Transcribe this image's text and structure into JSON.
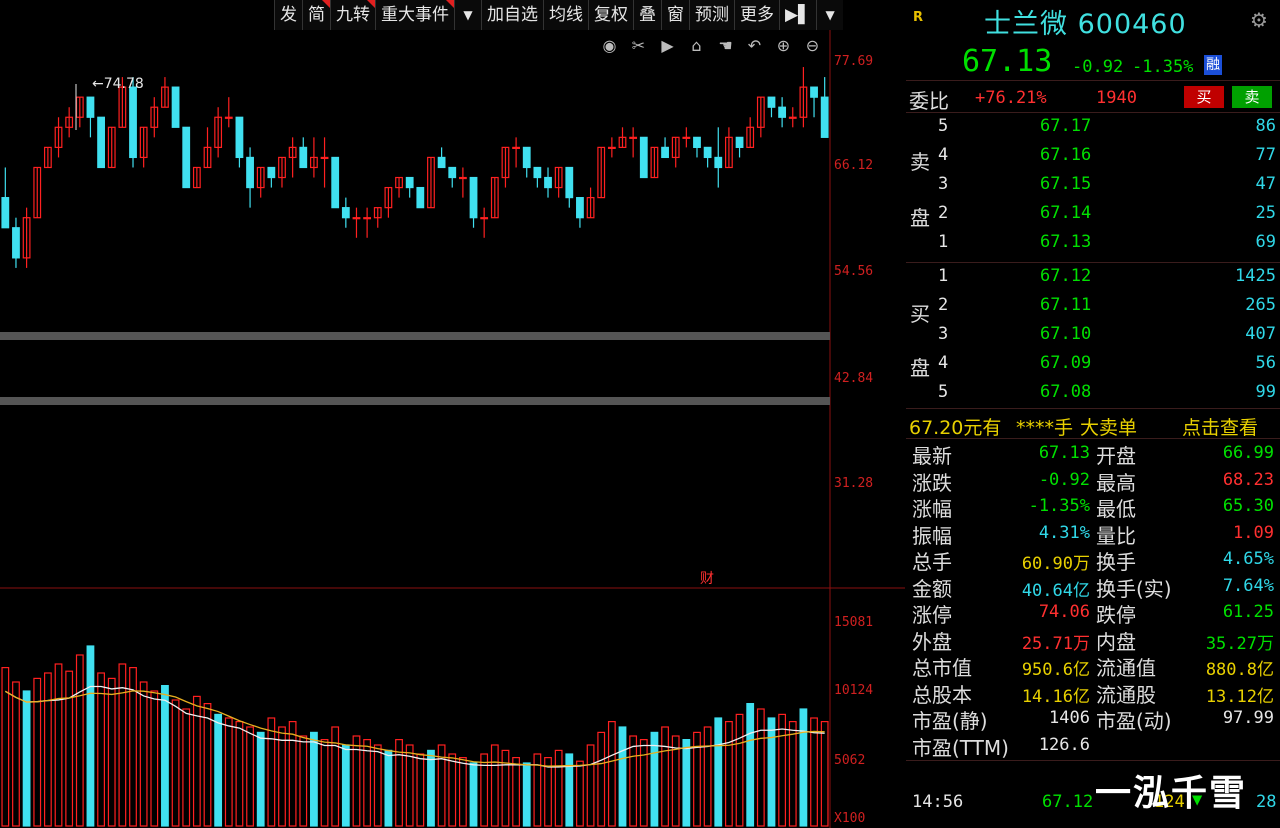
{
  "toolbar": [
    {
      "label": "发",
      "flag": false
    },
    {
      "label": "简",
      "flag": true
    },
    {
      "label": "九转",
      "flag": true
    },
    {
      "label": "重大事件",
      "flag": true
    },
    {
      "label": "▼",
      "flag": false
    },
    {
      "label": "加自选",
      "flag": false
    },
    {
      "label": "均线",
      "flag": false
    },
    {
      "label": "复权",
      "flag": false
    },
    {
      "label": "叠",
      "flag": false
    },
    {
      "label": "窗",
      "flag": false
    },
    {
      "label": "预测",
      "flag": false
    },
    {
      "label": "更多",
      "flag": false
    },
    {
      "label": "▶▌",
      "flag": false
    },
    {
      "label": "▼",
      "flag": false
    }
  ],
  "chart_tools": [
    "eye-icon",
    "scissors-icon",
    "play-icon",
    "lock-icon",
    "hand-icon",
    "undo-icon",
    "zoom-in-icon",
    "zoom-out-icon"
  ],
  "price_axis": [
    "77.69",
    "66.12",
    "54.56",
    "42.84",
    "31.28"
  ],
  "volume_axis": [
    "15081",
    "10124",
    "5062",
    "X100"
  ],
  "high_marker": "74.78",
  "cai_marker": "财",
  "chart_data": {
    "type": "candlestick",
    "series_colors": {
      "up": "#ff2020",
      "down": "#40e0f0",
      "ma_short": "#f0f0f0",
      "ma_long": "#e8b020"
    },
    "ohlc": [
      [
        63,
        66,
        60,
        60
      ],
      [
        60,
        61,
        57,
        56
      ],
      [
        57,
        62,
        61,
        56
      ],
      [
        61,
        66,
        66,
        61
      ],
      [
        66,
        68,
        68,
        66
      ],
      [
        68,
        71,
        70,
        67
      ],
      [
        70,
        72,
        71,
        69
      ],
      [
        71,
        73,
        73,
        70
      ],
      [
        73,
        73,
        71,
        69
      ],
      [
        71,
        71,
        66,
        66
      ],
      [
        66,
        70,
        70,
        66
      ],
      [
        70,
        75,
        74,
        70
      ],
      [
        74,
        75,
        67,
        66
      ],
      [
        67,
        70,
        70,
        66
      ],
      [
        70,
        73,
        72,
        69
      ],
      [
        72,
        75,
        74,
        72
      ],
      [
        74,
        74,
        70,
        70
      ],
      [
        70,
        70,
        64,
        64
      ],
      [
        64,
        66,
        66,
        64
      ],
      [
        66,
        70,
        68,
        66
      ],
      [
        68,
        72,
        71,
        67
      ],
      [
        71,
        73,
        71,
        70
      ],
      [
        71,
        71,
        67,
        66
      ],
      [
        67,
        68,
        64,
        62
      ],
      [
        64,
        66,
        66,
        63
      ],
      [
        66,
        66,
        65,
        64
      ],
      [
        65,
        67,
        67,
        64
      ],
      [
        67,
        69,
        68,
        65
      ],
      [
        68,
        69,
        66,
        66
      ],
      [
        66,
        69,
        67,
        65
      ],
      [
        67,
        69,
        67,
        64
      ],
      [
        67,
        67,
        62,
        62
      ],
      [
        62,
        63,
        61,
        60
      ],
      [
        61,
        62,
        61,
        59
      ],
      [
        61,
        62,
        61,
        59
      ],
      [
        61,
        62,
        62,
        60
      ],
      [
        62,
        64,
        64,
        61
      ],
      [
        64,
        65,
        65,
        63
      ],
      [
        65,
        65,
        64,
        63
      ],
      [
        64,
        64,
        62,
        62
      ],
      [
        62,
        67,
        67,
        62
      ],
      [
        67,
        68,
        66,
        66
      ],
      [
        66,
        66,
        65,
        64
      ],
      [
        65,
        66,
        65,
        63
      ],
      [
        65,
        65,
        61,
        60
      ],
      [
        61,
        62,
        61,
        59
      ],
      [
        61,
        65,
        65,
        61
      ],
      [
        65,
        68,
        68,
        64
      ],
      [
        68,
        69,
        68,
        66
      ],
      [
        68,
        68,
        66,
        65
      ],
      [
        66,
        66,
        65,
        64
      ],
      [
        65,
        66,
        64,
        63
      ],
      [
        64,
        66,
        66,
        63
      ],
      [
        66,
        66,
        63,
        62
      ],
      [
        63,
        63,
        61,
        60
      ],
      [
        61,
        64,
        63,
        61
      ],
      [
        63,
        68,
        68,
        63
      ],
      [
        68,
        69,
        68,
        67
      ],
      [
        68,
        70,
        69,
        68
      ],
      [
        69,
        70,
        69,
        67
      ],
      [
        69,
        69,
        65,
        65
      ],
      [
        65,
        68,
        68,
        65
      ],
      [
        68,
        69,
        67,
        67
      ],
      [
        67,
        69,
        69,
        66
      ],
      [
        69,
        70,
        69,
        68
      ],
      [
        69,
        69,
        68,
        67
      ],
      [
        68,
        68,
        67,
        66
      ],
      [
        67,
        70,
        66,
        64
      ],
      [
        66,
        70,
        69,
        66
      ],
      [
        69,
        69,
        68,
        67
      ],
      [
        68,
        71,
        70,
        68
      ],
      [
        70,
        73,
        73,
        69
      ],
      [
        73,
        73,
        72,
        71
      ],
      [
        72,
        73,
        71,
        70
      ],
      [
        71,
        72,
        71,
        70
      ],
      [
        71,
        76,
        74,
        70
      ],
      [
        74,
        74,
        73,
        71
      ],
      [
        73,
        75,
        69,
        69
      ]
    ],
    "volume": [
      [
        88,
        0
      ],
      [
        80,
        0
      ],
      [
        75,
        1
      ],
      [
        82,
        0
      ],
      [
        85,
        0
      ],
      [
        90,
        0
      ],
      [
        86,
        0
      ],
      [
        95,
        0
      ],
      [
        100,
        1
      ],
      [
        85,
        0
      ],
      [
        82,
        0
      ],
      [
        90,
        0
      ],
      [
        88,
        0
      ],
      [
        80,
        0
      ],
      [
        75,
        0
      ],
      [
        78,
        1
      ],
      [
        70,
        0
      ],
      [
        65,
        0
      ],
      [
        72,
        0
      ],
      [
        68,
        0
      ],
      [
        62,
        1
      ],
      [
        60,
        0
      ],
      [
        58,
        0
      ],
      [
        55,
        0
      ],
      [
        52,
        1
      ],
      [
        60,
        0
      ],
      [
        55,
        0
      ],
      [
        58,
        0
      ],
      [
        50,
        0
      ],
      [
        52,
        1
      ],
      [
        48,
        0
      ],
      [
        55,
        0
      ],
      [
        45,
        1
      ],
      [
        50,
        0
      ],
      [
        48,
        0
      ],
      [
        45,
        0
      ],
      [
        42,
        1
      ],
      [
        48,
        0
      ],
      [
        45,
        0
      ],
      [
        40,
        0
      ],
      [
        42,
        1
      ],
      [
        45,
        0
      ],
      [
        40,
        0
      ],
      [
        38,
        0
      ],
      [
        35,
        1
      ],
      [
        40,
        0
      ],
      [
        45,
        0
      ],
      [
        42,
        0
      ],
      [
        38,
        0
      ],
      [
        35,
        1
      ],
      [
        40,
        0
      ],
      [
        38,
        0
      ],
      [
        42,
        0
      ],
      [
        40,
        1
      ],
      [
        36,
        0
      ],
      [
        45,
        0
      ],
      [
        52,
        0
      ],
      [
        58,
        0
      ],
      [
        55,
        1
      ],
      [
        50,
        0
      ],
      [
        48,
        0
      ],
      [
        52,
        1
      ],
      [
        55,
        0
      ],
      [
        50,
        0
      ],
      [
        48,
        1
      ],
      [
        52,
        0
      ],
      [
        55,
        0
      ],
      [
        60,
        1
      ],
      [
        58,
        0
      ],
      [
        62,
        0
      ],
      [
        68,
        1
      ],
      [
        65,
        0
      ],
      [
        60,
        1
      ],
      [
        62,
        0
      ],
      [
        58,
        0
      ],
      [
        65,
        1
      ],
      [
        60,
        0
      ],
      [
        58,
        0
      ]
    ]
  },
  "stock": {
    "badge": "R",
    "name": "士兰微",
    "code": "600460",
    "price": "67.13",
    "change": "-0.92",
    "change_pct": "-1.35%",
    "rong": "融"
  },
  "weibi": {
    "label": "委比",
    "pct": "+76.21%",
    "diff": "1940",
    "buy": "买",
    "sell": "卖"
  },
  "sell_side": {
    "label_chars": [
      "卖",
      "盘"
    ],
    "rows": [
      {
        "lvl": "5",
        "price": "67.17",
        "vol": "86"
      },
      {
        "lvl": "4",
        "price": "67.16",
        "vol": "77"
      },
      {
        "lvl": "3",
        "price": "67.15",
        "vol": "47"
      },
      {
        "lvl": "2",
        "price": "67.14",
        "vol": "25"
      },
      {
        "lvl": "1",
        "price": "67.13",
        "vol": "69"
      }
    ]
  },
  "buy_side": {
    "label_chars": [
      "买",
      "盘"
    ],
    "rows": [
      {
        "lvl": "1",
        "price": "67.12",
        "vol": "1425"
      },
      {
        "lvl": "2",
        "price": "67.11",
        "vol": "265"
      },
      {
        "lvl": "3",
        "price": "67.10",
        "vol": "407"
      },
      {
        "lvl": "4",
        "price": "67.09",
        "vol": "56"
      },
      {
        "lvl": "5",
        "price": "67.08",
        "vol": "99"
      }
    ]
  },
  "bigorder": {
    "price": "67.20元有",
    "amt": "****手",
    "type": "大卖单",
    "link": "点击查看"
  },
  "quote": [
    {
      "l": "最新",
      "v": "67.13",
      "vc": "grn",
      "l2": "开盘",
      "v2": "66.99",
      "v2c": "grn"
    },
    {
      "l": "涨跌",
      "v": "-0.92",
      "vc": "grn",
      "l2": "最高",
      "v2": "68.23",
      "v2c": "red"
    },
    {
      "l": "涨幅",
      "v": "-1.35%",
      "vc": "grn",
      "l2": "最低",
      "v2": "65.30",
      "v2c": "grn"
    },
    {
      "l": "振幅",
      "v": "4.31%",
      "vc": "cyan",
      "l2": "量比",
      "v2": "1.09",
      "v2c": "red"
    },
    {
      "l": "总手",
      "v": "60.90万",
      "vc": "yel",
      "l2": "换手",
      "v2": "4.65%",
      "v2c": "cyan"
    },
    {
      "l": "金额",
      "v": "40.64亿",
      "vc": "cyan",
      "l2": "换手(实)",
      "v2": "7.64%",
      "v2c": "cyan"
    },
    {
      "l": "涨停",
      "v": "74.06",
      "vc": "red",
      "l2": "跌停",
      "v2": "61.25",
      "v2c": "grn"
    },
    {
      "l": "外盘",
      "v": "25.71万",
      "vc": "red",
      "l2": "内盘",
      "v2": "35.27万",
      "v2c": "grn"
    },
    {
      "l": "总市值",
      "v": "950.6亿",
      "vc": "yel",
      "l2": "流通值",
      "v2": "880.8亿",
      "v2c": "yel"
    },
    {
      "l": "总股本",
      "v": "14.16亿",
      "vc": "yel",
      "l2": "流通股",
      "v2": "13.12亿",
      "v2c": "yel"
    },
    {
      "l": "市盈(静)",
      "v": "1406",
      "vc": "wht",
      "l2": "市盈(动)",
      "v2": "97.99",
      "v2c": "wht"
    },
    {
      "l": "市盈(TTM)",
      "v": "126.6",
      "vc": "wht",
      "l2": "",
      "v2": "",
      "v2c": "wht"
    }
  ],
  "tick": {
    "time": "14:56",
    "price": "67.12",
    "vol": "124",
    "arrow": "▼",
    "num": "28"
  },
  "watermark": "一泓千雪"
}
